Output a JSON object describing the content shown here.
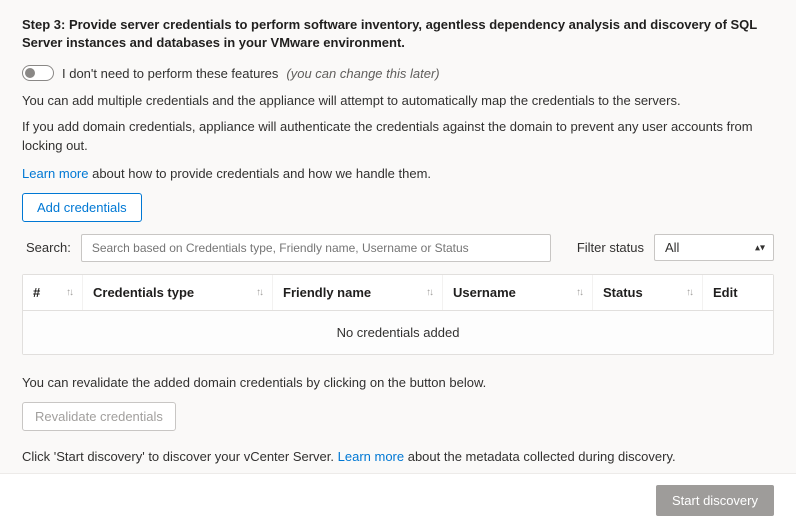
{
  "step": {
    "title": "Step 3: Provide server credentials to perform software inventory, agentless dependency analysis and discovery of SQL Server instances and databases in your VMware environment."
  },
  "toggle": {
    "label": "I don't need to perform these features",
    "hint": "(you can change this later)"
  },
  "desc1": "You can add multiple credentials and the appliance will attempt to automatically map the credentials to the servers.",
  "desc2": "If you add domain credentials, appliance will authenticate the credentials against  the domain to prevent any user accounts from locking out.",
  "learn": {
    "link": "Learn more",
    "rest": " about how to provide credentials and how we handle them."
  },
  "buttons": {
    "add": "Add credentials",
    "revalidate": "Revalidate credentials",
    "start": "Start discovery"
  },
  "search": {
    "label": "Search:",
    "placeholder": "Search based on Credentials type, Friendly name, Username or Status"
  },
  "filter": {
    "label": "Filter status",
    "value": "All"
  },
  "table": {
    "headers": {
      "idx": "#",
      "type": "Credentials type",
      "name": "Friendly name",
      "user": "Username",
      "status": "Status",
      "edit": "Edit"
    },
    "empty": "No credentials added"
  },
  "revalidate_note": "You can revalidate the added domain credentials by clicking on the button below.",
  "discover_note": {
    "pre": "Click 'Start discovery' to discover your vCenter Server. ",
    "link": "Learn more",
    "post": " about the metadata collected during discovery."
  }
}
